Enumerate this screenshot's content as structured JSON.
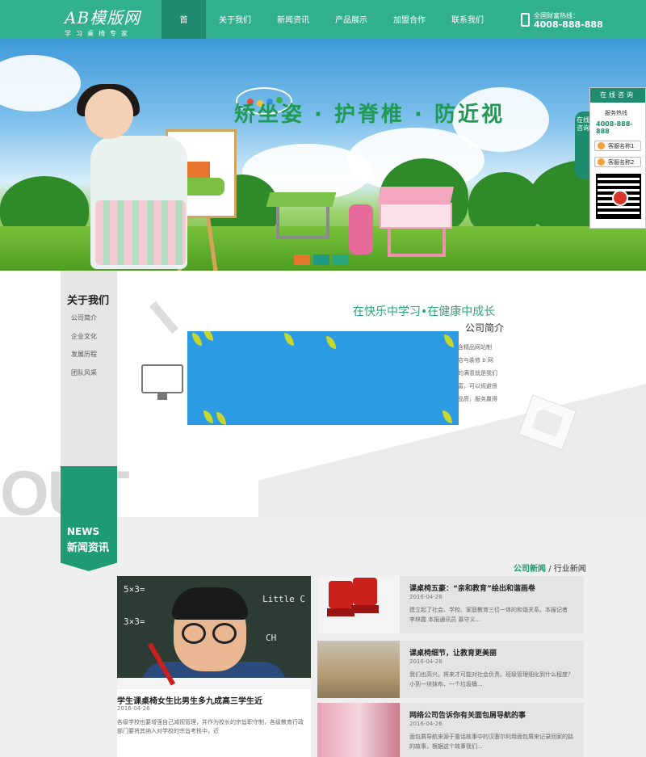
{
  "header": {
    "logo_main": "AB模版网",
    "logo_sub": "学习桌椅专家",
    "nav": [
      "首 页",
      "关于我们",
      "新闻资讯",
      "产品展示",
      "加盟合作",
      "联系我们"
    ],
    "hotline_label": "全国财富热线：",
    "hotline_number": "4008-888-888",
    "accent_color": "#31b08f"
  },
  "banner": {
    "slogan": "矫坐姿 · 护脊椎 · 防近视",
    "slide_colors": [
      "#e8762f",
      "#1f9b83",
      "#2aa67d"
    ]
  },
  "service": {
    "title": "在线咨询",
    "tab": "在线咨询",
    "hot_label": "服务热线",
    "number": "4008-888-888",
    "buttons": [
      "客服名称1",
      "客服名称2"
    ]
  },
  "about": {
    "menu_title": "关于我们",
    "menu": [
      "公司简介",
      "企业文化",
      "发展历程",
      "团队风采"
    ],
    "tagline": "在快乐中学习•在健康中成长",
    "heading": "公司简介",
    "text_lines": [
      "包含精品网站制",
      "开店与装修 b 网",
      "户的满意就是我们",
      "丰富，可以规避很",
      "优品质，服务赢得"
    ],
    "watermark": "OUT"
  },
  "news": {
    "badge_en": "NEWS",
    "badge_cn": "新闻资讯",
    "tab_active": "公司新闻",
    "tab_sep": "/",
    "tab_other": "行业新闻",
    "featured": {
      "title": "学生课桌椅女生比男生多九成高三学生近",
      "date": "2016-04-26",
      "desc": "各级学校也要增强自己减视管理，并作为校长的宗旨职守制，各级教育行政部门要将其纳入对学校的宗旨考核中，近"
    },
    "items": [
      {
        "title": "课桌椅五豪：“亲和教育”绘出和谐画卷",
        "date": "2016-04-26",
        "desc": "建立起了社会、学校、家庭教育三位一体的和谐关系。本报记者 李林霞 本报通讯员 慕守义..."
      },
      {
        "title": "课桌椅细节，让教育更美丽",
        "date": "2016-04-26",
        "desc": "我们也高兴。将来才可能对社会负责。班级管理细化到什么程度？小到一块抹布、一个垃圾桶..."
      },
      {
        "title": "网络公司告诉你有关面包屑导航的事",
        "date": "2016-04-26",
        "desc": "面包屑导航来源于童话故事中的汉塞尔利用面包屑来记录回家的路的故事，根据这个故事我们..."
      }
    ]
  }
}
